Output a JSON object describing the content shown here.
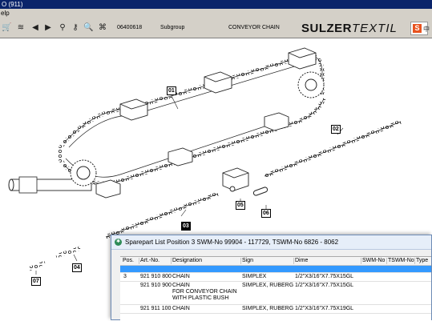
{
  "titlebar": {
    "text": "O (911)"
  },
  "menubar": {
    "help_label": "elp"
  },
  "toolbar": {
    "number": "06400618",
    "subgroup_label": "Subgroup",
    "subgroup_value": "CONVEYOR CHAIN",
    "logo_bold": "SULZER",
    "logo_thin": "TEXTIL",
    "badge_letter": "S",
    "badge_text": "中"
  },
  "drawing": {
    "callouts": [
      "01",
      "02",
      "03",
      "05",
      "06",
      "04",
      "07"
    ]
  },
  "sparepart_window": {
    "title": "Sparepart List Position 3 SWM-No 99904 - 117729, TSWM-No 6826 - 8062",
    "columns": [
      "Pos.",
      "Art.-No.",
      "Designation",
      "Sign",
      "Dime",
      "SWM-No",
      "TSWM-No",
      "Type"
    ],
    "rows": [
      {
        "pos": "",
        "art": "",
        "designation": "",
        "sign": "",
        "dime": ""
      },
      {
        "pos": "3",
        "art": "921 910 800",
        "designation": "CHAIN",
        "sign": "SIMPLEX",
        "dime": "1/2\"X3/16\"X7.75X15GL"
      },
      {
        "pos": "",
        "art": "921 910 900",
        "designation": "CHAIN",
        "designation2": "FOR CONVEYOR CHAIN",
        "designation3": "WITH PLASTIC BUSH",
        "sign": "SIMPLEX, RUBERG",
        "dime": "1/2\"X3/16\"X7.75X15GL"
      },
      {
        "pos": "",
        "art": "921 911 100",
        "designation": "CHAIN",
        "sign": "SIMPLEX, RUBERG",
        "dime": "1/2\"X3/16\"X7.75X19GL"
      }
    ]
  },
  "colors": {
    "titlebar": "#0a246a",
    "chrome": "#d4d0c8",
    "selection": "#3399ff",
    "badge": "#e8531f"
  }
}
